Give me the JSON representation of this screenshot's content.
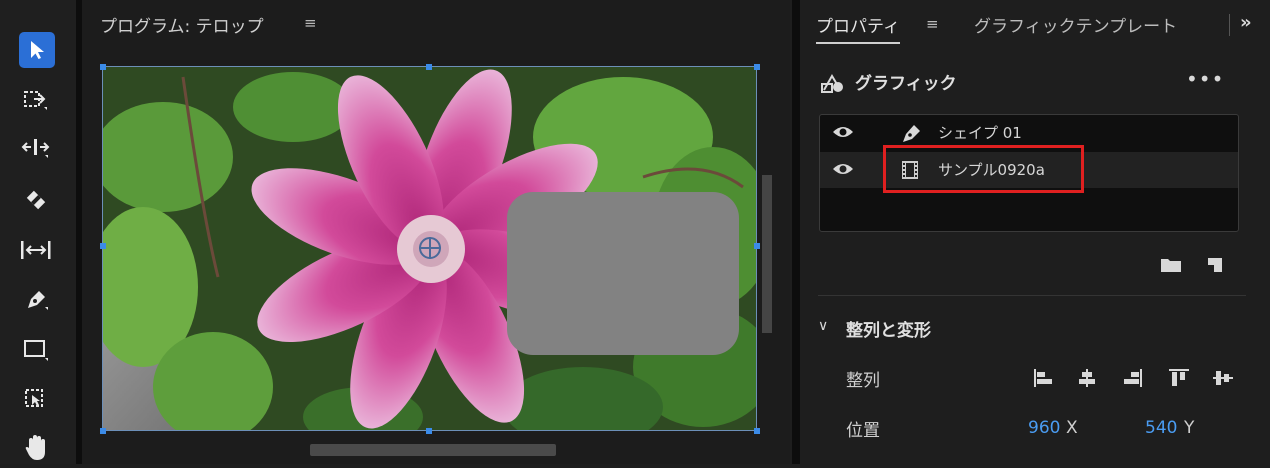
{
  "colors": {
    "accent": "#2b6fd6",
    "value_blue": "#4a9cf2",
    "highlight_red": "#e02020"
  },
  "toolbar": {
    "tools": [
      "selection-tool",
      "track-select-tool",
      "ripple-edit-tool",
      "razor-tool",
      "slip-tool",
      "pen-tool",
      "rectangle-tool",
      "hand-tool-group",
      "hand-tool"
    ],
    "active": "selection-tool"
  },
  "program": {
    "title": "プログラム: テロップ",
    "menu_icon": "≡"
  },
  "properties": {
    "tab_label": "プロパティ",
    "tab_menu_icon": "≡",
    "tab_graphic_template": "グラフィックテンプレート",
    "overflow": "»",
    "graphic_title": "グラフィック",
    "more": "•••",
    "layers": [
      {
        "name": "シェイプ 01",
        "icon": "pen-icon"
      },
      {
        "name": "サンプル0920a",
        "icon": "film-icon"
      }
    ],
    "section_chevron": "∨",
    "section_title": "整列と変形",
    "align_label": "整列",
    "position_label": "位置",
    "position_x": "960",
    "position_x_unit": "X",
    "position_y": "540",
    "position_y_unit": "Y"
  }
}
